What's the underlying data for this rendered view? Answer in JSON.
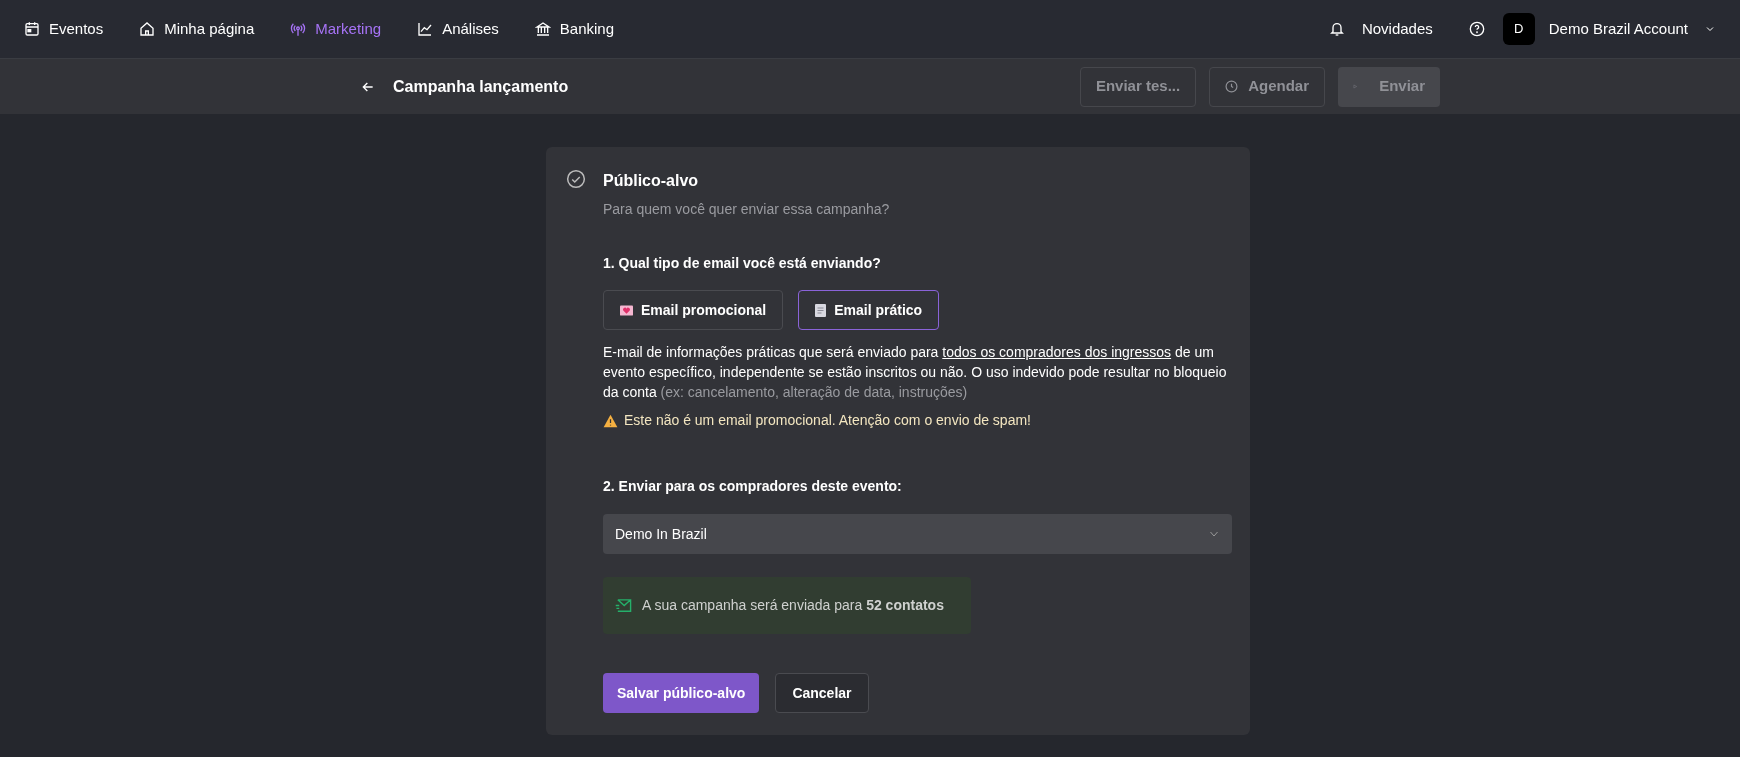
{
  "nav": {
    "items": [
      {
        "label": "Eventos",
        "kind": "calendar",
        "selected": false
      },
      {
        "label": "Minha página",
        "kind": "home",
        "selected": false
      },
      {
        "label": "Marketing",
        "kind": "broadcast",
        "selected": true
      },
      {
        "label": "Análises",
        "kind": "chart",
        "selected": false
      },
      {
        "label": "Banking",
        "kind": "bank",
        "selected": false
      }
    ],
    "news": "Novidades",
    "avatar": "D",
    "account": "Demo Brazil Account"
  },
  "subheader": {
    "title": "Campanha lançamento",
    "buttons": [
      {
        "label": "Enviar tes...",
        "kind": "outline",
        "disabled": true
      },
      {
        "label": "Agendar",
        "kind": "schedule",
        "disabled": true
      },
      {
        "label": "Enviar",
        "kind": "send",
        "disabled": true
      }
    ]
  },
  "card": {
    "title": "Público-alvo",
    "subtitle": "Para quem você quer enviar essa campanha?",
    "question1": "1. Qual tipo de email você está enviando?",
    "types": [
      {
        "label": "Email promocional",
        "kind": "promo",
        "selected": false
      },
      {
        "label": "Email prático",
        "kind": "practical",
        "selected": true
      }
    ],
    "description": {
      "before": "E-mail de informações práticas que será enviado para",
      "link": "todos os compradores dos ingressos",
      "after": "de um evento específico, independente se estão inscritos ou não. O uso indevido pode resultar no bloqueio da conta",
      "hint": "(ex: cancelamento, alteração de data, instruções)"
    },
    "warning": "Este não é um email promocional. Atenção com o envio de spam!",
    "question2": "2. Enviar para os compradores deste evento:",
    "event_select": {
      "value": "Demo In Brazil"
    },
    "info": "A sua campanha será enviada para **52 contatos**",
    "buttons": [
      {
        "label": "Salvar público-alvo",
        "kind": "primary"
      },
      {
        "label": "Cancelar",
        "kind": "secondary"
      }
    ]
  }
}
